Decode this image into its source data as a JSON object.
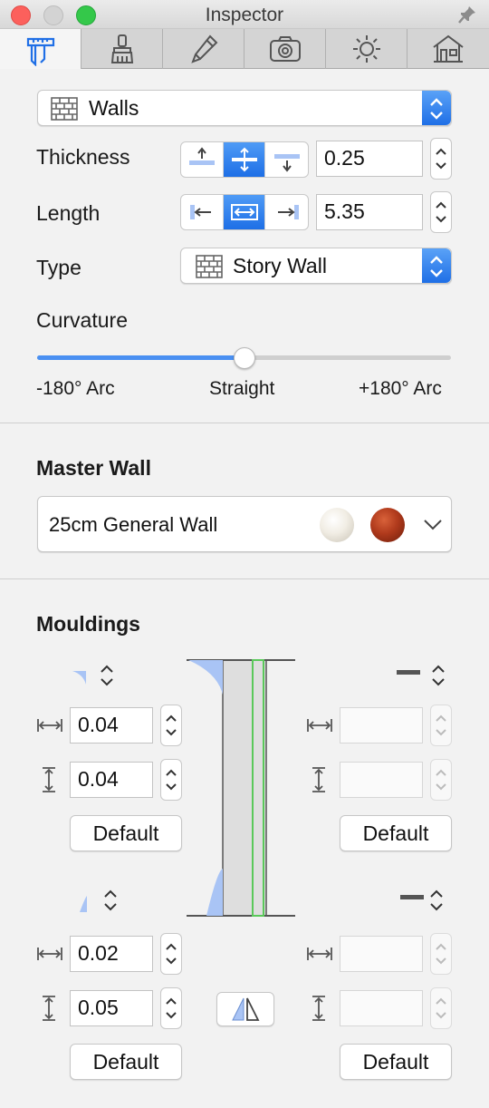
{
  "window": {
    "title": "Inspector"
  },
  "tabs": [
    {
      "icon": "caliper-icon",
      "active": true
    },
    {
      "icon": "brush-icon",
      "active": false
    },
    {
      "icon": "pencil-icon",
      "active": false
    },
    {
      "icon": "camera-icon",
      "active": false
    },
    {
      "icon": "sun-icon",
      "active": false
    },
    {
      "icon": "house-icon",
      "active": false
    }
  ],
  "object_selector": {
    "value": "Walls",
    "icon": "brick-wall-icon"
  },
  "thickness": {
    "label": "Thickness",
    "value": "0.25",
    "alignment": [
      "top",
      "center",
      "bottom"
    ],
    "selected": "center"
  },
  "length": {
    "label": "Length",
    "value": "5.35",
    "alignment": [
      "left",
      "center",
      "right"
    ],
    "selected": "center"
  },
  "type": {
    "label": "Type",
    "value": "Story Wall",
    "icon": "brick-wall-icon"
  },
  "curvature": {
    "label": "Curvature",
    "min_label": "-180° Arc",
    "mid_label": "Straight",
    "max_label": "+180° Arc",
    "value_fraction": 0.5
  },
  "master_wall": {
    "heading": "Master Wall",
    "value": "25cm General Wall",
    "swatches": [
      "#f4f1ea",
      "#b03a1c"
    ]
  },
  "mouldings": {
    "heading": "Mouldings",
    "top_left": {
      "width": "0.04",
      "height": "0.04",
      "default_label": "Default"
    },
    "top_right": {
      "width": "",
      "height": "",
      "default_label": "Default"
    },
    "bottom_left": {
      "width": "0.02",
      "height": "0.05",
      "default_label": "Default"
    },
    "bottom_right": {
      "width": "",
      "height": "",
      "default_label": "Default"
    }
  },
  "colors": {
    "accent": "#1f6fe6",
    "moulding_fill": "#a9c4f5",
    "wall_line": "#5ac85a"
  }
}
